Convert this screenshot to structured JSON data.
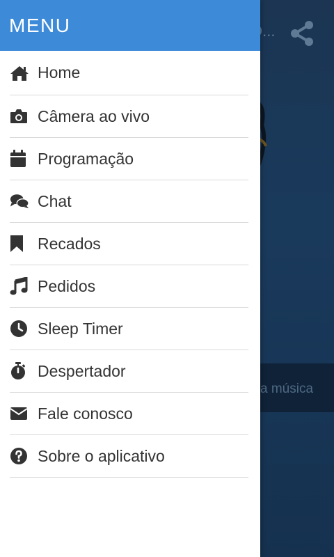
{
  "background": {
    "title_fragment": "O...",
    "now_playing_fragment": "a música",
    "share_icon": "share-icon"
  },
  "drawer": {
    "title": "MENU",
    "accent_color": "#3d8ad8",
    "items": [
      {
        "label": "Home",
        "icon": "home-icon"
      },
      {
        "label": "Câmera ao vivo",
        "icon": "camera-icon"
      },
      {
        "label": "Programação",
        "icon": "calendar-icon"
      },
      {
        "label": "Chat",
        "icon": "chat-icon"
      },
      {
        "label": "Recados",
        "icon": "bookmark-icon"
      },
      {
        "label": "Pedidos",
        "icon": "music-icon"
      },
      {
        "label": "Sleep Timer",
        "icon": "clock-icon"
      },
      {
        "label": "Despertador",
        "icon": "stopwatch-icon"
      },
      {
        "label": "Fale conosco",
        "icon": "envelope-icon"
      },
      {
        "label": "Sobre o aplicativo",
        "icon": "question-icon"
      }
    ]
  }
}
